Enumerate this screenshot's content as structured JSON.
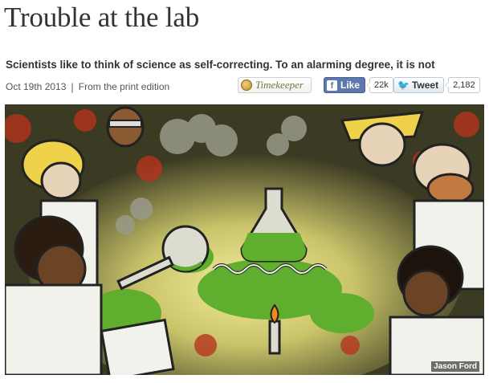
{
  "article": {
    "headline": "Trouble at the lab",
    "rubric": "Scientists like to think of science as self-correcting. To an alarming degree, it is not",
    "date": "Oct 19th 2013",
    "separator": "|",
    "edition": "From the print edition"
  },
  "social": {
    "timekeeper_label": "Timekeeper",
    "facebook_label": "Like",
    "facebook_icon_glyph": "f",
    "facebook_count": "22k",
    "twitter_label": "Tweet",
    "twitter_icon_glyph": "🐦",
    "twitter_count": "2,182"
  },
  "image": {
    "credit": "Jason Ford"
  },
  "colors": {
    "facebook_blue": "#5f78ab",
    "twitter_blue": "#2ca7e0",
    "timekeeper_green": "#6b7d3a",
    "slime_green": "#5fae2e",
    "illustration_bg": "#3b3a22",
    "spot_red": "#b6351e",
    "glow_yellow": "#efe38e"
  }
}
